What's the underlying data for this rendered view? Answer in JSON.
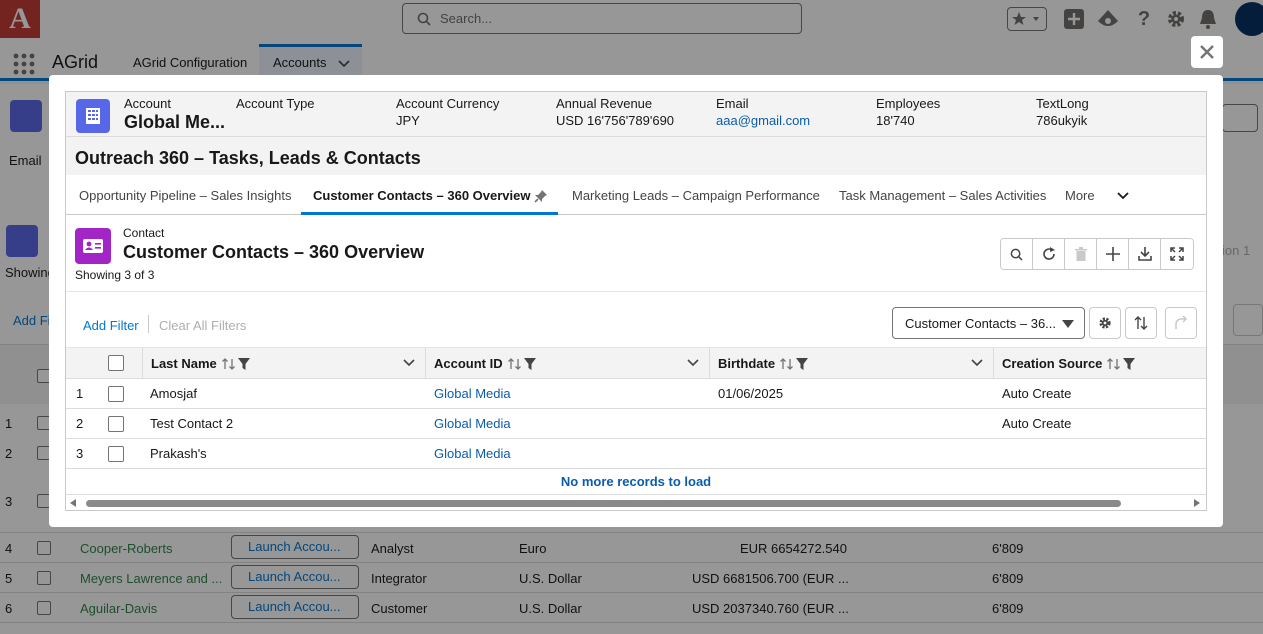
{
  "global_header": {
    "logo_text": "A",
    "search_placeholder": "Search..."
  },
  "nav": {
    "app_name": "AGrid",
    "tabs": [
      {
        "label": "AGrid Configuration"
      },
      {
        "label": "Accounts"
      }
    ]
  },
  "background": {
    "email_label": "Email",
    "showing_label": "Showing",
    "add_filter_label": "Add Fi",
    "option_label": "ion 1",
    "row_numbers": [
      "1",
      "2",
      "3"
    ],
    "rows": [
      {
        "num": "4",
        "name": "Cooper-Roberts",
        "button": "Launch Accou...",
        "type": "Analyst",
        "currency": "Euro",
        "revenue": "EUR 6654272.540",
        "employees": "6'809"
      },
      {
        "num": "5",
        "name": "Meyers Lawrence and ...",
        "button": "Launch Accou...",
        "type": "Integrator",
        "currency": "U.S. Dollar",
        "revenue": "USD 6681506.700 (EUR ...",
        "employees": "6'809"
      },
      {
        "num": "6",
        "name": "Aguilar-Davis",
        "button": "Launch Accou...",
        "type": "Customer",
        "currency": "U.S. Dollar",
        "revenue": "USD 2037340.760 (EUR ...",
        "employees": "6'809"
      }
    ]
  },
  "record": {
    "fields": [
      {
        "label": "Account",
        "value": "Global Me..."
      },
      {
        "label": "Account Type",
        "value": ""
      },
      {
        "label": "Account Currency",
        "value": "JPY"
      },
      {
        "label": "Annual Revenue",
        "value": "USD 16'756'789'690"
      },
      {
        "label": "Email",
        "value": "aaa@gmail.com"
      },
      {
        "label": "Employees",
        "value": "18'740"
      },
      {
        "label": "TextLong",
        "value": "786ukyik"
      }
    ]
  },
  "card": {
    "title": "Outreach 360 – Tasks, Leads & Contacts",
    "tabs": [
      {
        "label": "Opportunity Pipeline – Sales Insights"
      },
      {
        "label": "Customer Contacts – 360 Overview"
      },
      {
        "label": "Marketing Leads – Campaign Performance"
      },
      {
        "label": "Task Management – Sales Activities"
      },
      {
        "label": "More"
      }
    ]
  },
  "list": {
    "object_label": "Contact",
    "title": "Customer Contacts – 360 Overview",
    "showing": "Showing 3 of 3",
    "add_filter": "Add Filter",
    "clear_filters": "Clear All Filters",
    "view_selected": "Customer Contacts – 36...",
    "columns": [
      {
        "label": "Last Name"
      },
      {
        "label": "Account ID"
      },
      {
        "label": "Birthdate"
      },
      {
        "label": "Creation Source"
      }
    ],
    "rows": [
      {
        "num": "1",
        "last_name": "Amosjaf",
        "account": "Global Media",
        "birthdate": "01/06/2025",
        "source": "Auto Create"
      },
      {
        "num": "2",
        "last_name": "Test Contact 2",
        "account": "Global Media",
        "birthdate": "",
        "source": "Auto Create"
      },
      {
        "num": "3",
        "last_name": "Prakash's",
        "account": "Global Media",
        "birthdate": "",
        "source": ""
      }
    ],
    "no_more": "No more records to load"
  },
  "colors": {
    "brand_blue": "#0176d3",
    "account_icon": "#5867e8",
    "contact_icon": "#a225c6",
    "link": "#0b5cab",
    "bg_link_green": "#2e844a"
  }
}
